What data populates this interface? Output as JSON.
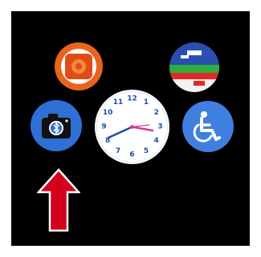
{
  "apps": [
    {
      "id": "toolbox",
      "icon": "toolbox-icon",
      "color": "#e85a1c"
    },
    {
      "id": "flag",
      "icon": "flag-icon",
      "color": "#2a4fb0"
    },
    {
      "id": "camera",
      "icon": "bluetooth-camera-icon",
      "color": "#2f6fd6"
    },
    {
      "id": "clock",
      "icon": "analog-clock-icon",
      "color": "#ffffff"
    },
    {
      "id": "accessibility",
      "icon": "wheelchair-icon",
      "color": "#3e7fe0"
    }
  ],
  "clock": {
    "numerals": [
      "12",
      "1",
      "2",
      "3",
      "4",
      "5",
      "6",
      "7",
      "8",
      "9",
      "10",
      "11"
    ],
    "hour_hand_color": "#d83c8a",
    "minute_hand_color": "#1a4fae"
  },
  "pointer": {
    "icon": "arrow-up-icon",
    "color": "#d4001c",
    "outline": "#ffffff"
  }
}
